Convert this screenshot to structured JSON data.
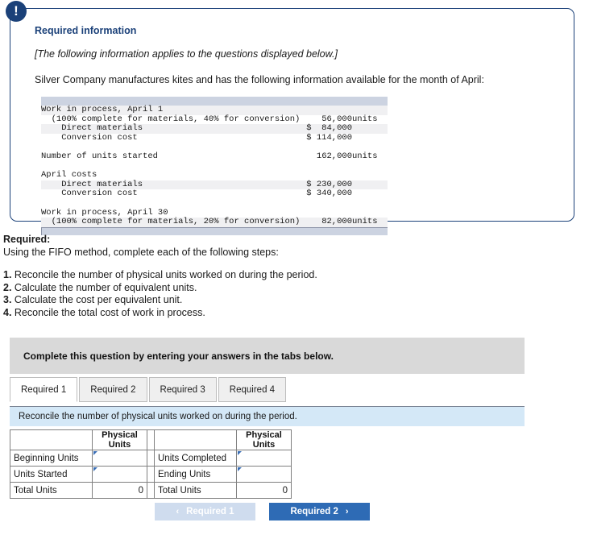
{
  "alert": {
    "icon": "exclamation-icon",
    "glyph": "!"
  },
  "info_panel": {
    "title": "Required information",
    "applies_note": "[The following information applies to the questions displayed below.]",
    "intro": "Silver Company manufactures kites and has the following information available for the month of April:",
    "data_table": {
      "rows": [
        {
          "label": "Work in process, April 1",
          "amount": "",
          "unit": ""
        },
        {
          "label": "  (100% complete for materials, 40% for conversion)",
          "amount": "56,000",
          "unit": "units"
        },
        {
          "label": "    Direct materials",
          "amount": "$  84,000",
          "unit": ""
        },
        {
          "label": "    Conversion cost",
          "amount": "$ 114,000",
          "unit": ""
        },
        {
          "label": "",
          "amount": "",
          "unit": ""
        },
        {
          "label": "Number of units started",
          "amount": "162,000",
          "unit": "units"
        },
        {
          "label": "",
          "amount": "",
          "unit": ""
        },
        {
          "label": "April costs",
          "amount": "",
          "unit": ""
        },
        {
          "label": "    Direct materials",
          "amount": "$ 230,000",
          "unit": ""
        },
        {
          "label": "    Conversion cost",
          "amount": "$ 340,000",
          "unit": ""
        },
        {
          "label": "",
          "amount": "",
          "unit": ""
        },
        {
          "label": "Work in process, April 30",
          "amount": "",
          "unit": ""
        },
        {
          "label": "  (100% complete for materials, 20% for conversion)",
          "amount": "82,000",
          "unit": "units"
        }
      ]
    }
  },
  "required": {
    "heading": "Required:",
    "subheading": "Using the FIFO method, complete each of the following steps:",
    "steps": [
      {
        "num": "1.",
        "text": "Reconcile the number of physical units worked on during the period."
      },
      {
        "num": "2.",
        "text": "Calculate the number of equivalent units."
      },
      {
        "num": "3.",
        "text": "Calculate the cost per equivalent unit."
      },
      {
        "num": "4.",
        "text": "Reconcile the total cost of work in process."
      }
    ]
  },
  "instruction_bar": {
    "text": "Complete this question by entering your answers in the tabs below."
  },
  "tabs": [
    {
      "label": "Required 1",
      "active": true
    },
    {
      "label": "Required 2",
      "active": false
    },
    {
      "label": "Required 3",
      "active": false
    },
    {
      "label": "Required 4",
      "active": false
    }
  ],
  "sub_instruction": {
    "text": "Reconcile the number of physical units worked on during the period."
  },
  "answer_table": {
    "left": {
      "header_label": "",
      "header_value": "Physical\nUnits",
      "header_value_line1": "Physical",
      "header_value_line2": "Units",
      "rows": [
        {
          "label": "Beginning Units",
          "value": "",
          "type": "input"
        },
        {
          "label": "Units Started",
          "value": "",
          "type": "input"
        },
        {
          "label": "Total Units",
          "value": "0",
          "type": "total"
        }
      ]
    },
    "right": {
      "header_value_line1": "Physical",
      "header_value_line2": "Units",
      "rows": [
        {
          "label": "Units Completed",
          "value": "",
          "type": "input"
        },
        {
          "label": "Ending Units",
          "value": "",
          "type": "input"
        },
        {
          "label": "Total Units",
          "value": "0",
          "type": "total"
        }
      ]
    }
  },
  "nav": {
    "prev": {
      "label": "Required 1",
      "chevron": "‹"
    },
    "next": {
      "label": "Required 2",
      "chevron": "›"
    }
  },
  "colors": {
    "panel_border": "#1b4179",
    "title_blue": "#1b4179",
    "header_blue": "#6fa1d6",
    "light_blue_bar": "#d4e8f7",
    "grey_bar": "#d9d9d9",
    "next_button": "#2e6bb5",
    "prev_button": "#cfdcee"
  }
}
